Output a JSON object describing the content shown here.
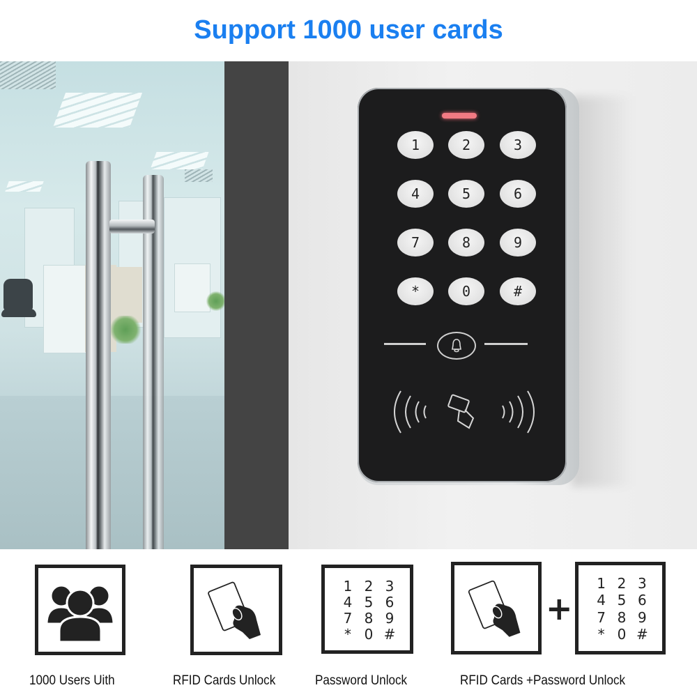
{
  "headline": "Support 1000 user cards",
  "colors": {
    "headline": "#1a7ff0",
    "device_face": "#1c1c1d",
    "indicator_led": "#f27a83",
    "icon_stroke": "#222222"
  },
  "device": {
    "keypad": [
      "1",
      "2",
      "3",
      "4",
      "5",
      "6",
      "7",
      "8",
      "9",
      "*",
      "0",
      "#"
    ],
    "bell_icon": "bell-icon",
    "rfid_icon": "rfid-wave-icon"
  },
  "features": [
    {
      "icon": "users-group-icon",
      "caption": "1000 Users Uith"
    },
    {
      "icon": "hand-card-icon",
      "caption": "RFID Cards Unlock"
    },
    {
      "icon": "keypad-icon",
      "caption": "Password Unlock",
      "keys": [
        "1",
        "2",
        "3",
        "4",
        "5",
        "6",
        "7",
        "8",
        "9",
        "*",
        "0",
        "#"
      ]
    },
    {
      "icon": "hand-card-icon",
      "caption": "RFID Cards +Password Unlock",
      "keys": [
        "1",
        "2",
        "3",
        "4",
        "5",
        "6",
        "7",
        "8",
        "9",
        "*",
        "0",
        "#"
      ],
      "joiner": "+"
    }
  ]
}
